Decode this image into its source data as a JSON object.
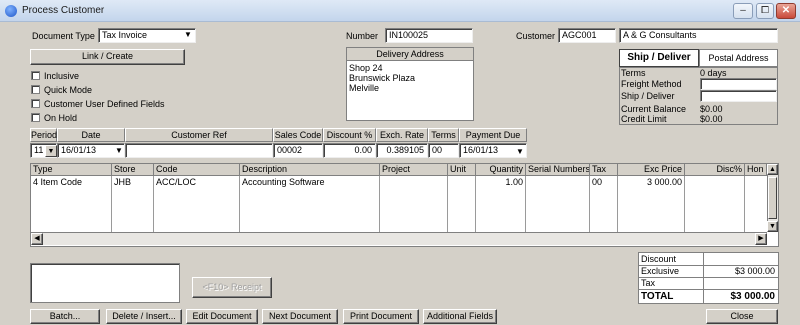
{
  "window": {
    "title": "Process Customer",
    "buttons": [
      "–",
      "⧠",
      "✕"
    ]
  },
  "header": {
    "doc_type_label": "Document Type",
    "doc_type_value": "Tax Invoice",
    "link_create": "Link / Create",
    "number_label": "Number",
    "number_value": "IN100025",
    "customer_label": "Customer",
    "customer_code": "AGC001",
    "customer_name": "A & G Consultants",
    "checkboxes": [
      "Inclusive",
      "Quick Mode",
      "Customer User Defined Fields",
      "On Hold"
    ]
  },
  "delivery": {
    "title": "Delivery Address",
    "lines": [
      "Shop 24",
      "Brunswick Plaza",
      "Melville"
    ]
  },
  "ship_tabs": {
    "active": "Ship / Deliver",
    "other": "Postal Address"
  },
  "info": {
    "terms_label": "Terms",
    "terms_value": "0 days",
    "freight_label": "Freight Method",
    "ship_label": "Ship / Deliver",
    "balance_label": "Current Balance",
    "balance_value": "$0.00",
    "credit_label": "Credit Limit",
    "credit_value": "$0.00"
  },
  "detail_headers": {
    "period": "Period",
    "date": "Date",
    "customer_ref": "Customer Ref",
    "sales_code": "Sales Code",
    "discount": "Discount %",
    "exch_rate": "Exch. Rate",
    "terms": "Terms",
    "payment_due": "Payment Due"
  },
  "detail_values": {
    "period": "11",
    "date": "16/01/13",
    "customer_ref": "",
    "sales_code": "00002",
    "discount": "0.00",
    "exch_rate": "0.389105",
    "terms": "00",
    "payment_due": "16/01/13"
  },
  "lines_table": {
    "columns": [
      "Type",
      "Store",
      "Code",
      "Description",
      "Project",
      "Unit",
      "Quantity",
      "Serial Numbers",
      "Tax",
      "Exc Price",
      "Disc%",
      "Hon"
    ],
    "rows": [
      [
        "4 Item Code",
        "JHB",
        "ACC/LOC",
        "Accounting Software",
        "",
        "",
        "1.00",
        "",
        "00",
        "3 000.00",
        "",
        ""
      ]
    ]
  },
  "totals": {
    "discount_label": "Discount",
    "discount_value": "",
    "exclusive_label": "Exclusive",
    "exclusive_value": "$3 000.00",
    "tax_label": "Tax",
    "tax_value": "",
    "total_label": "TOTAL",
    "total_value": "$3 000.00"
  },
  "f10_receipt": "<F10> Receipt",
  "footer": {
    "batch": "Batch...",
    "delete_insert": "Delete / Insert...",
    "edit_document": "Edit Document",
    "next_document": "Next Document",
    "print_document": "Print Document",
    "additional_fields": "Additional Fields",
    "close": "Close"
  }
}
